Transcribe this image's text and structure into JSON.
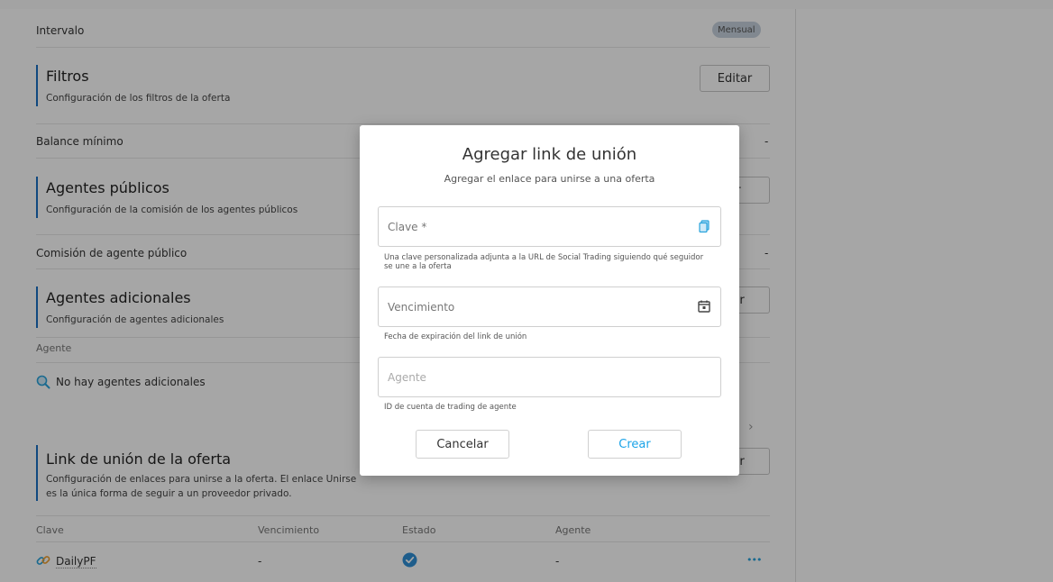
{
  "page": {
    "interval": {
      "label": "Intervalo",
      "badge": "Mensual"
    },
    "filters": {
      "title": "Filtros",
      "description": "Configuración de los filtros de la oferta",
      "edit_button": "Editar",
      "min_balance_label": "Balance mínimo",
      "min_balance_value": "-"
    },
    "public_agents": {
      "title": "Agentes públicos",
      "description": "Configuración de la comisión de los agentes públicos",
      "button_partial": "ar",
      "commission_label": "Comisión de agente público",
      "commission_value": "-"
    },
    "additional_agents": {
      "title": "Agentes adicionales",
      "description": "Configuración de agentes adicionales",
      "button_partial": "gar",
      "column_agent": "Agente",
      "empty_text": "No hay agentes adicionales",
      "chevron": "›"
    },
    "join_links": {
      "title": "Link de unión de la oferta",
      "description": "Configuración de enlaces para unirse a la oferta. El enlace Unirse es la única forma de seguir a un proveedor privado.",
      "button_partial": "gar",
      "columns": [
        "Clave",
        "Vencimiento",
        "Estado",
        "Agente"
      ],
      "rows": [
        {
          "key": "DailyPF",
          "expiry": "-",
          "agent": "-",
          "more": "•••"
        }
      ]
    }
  },
  "modal": {
    "title": "Agregar link de unión",
    "subtitle": "Agregar el enlace para unirse a una oferta",
    "key_field": {
      "placeholder": "Clave *",
      "helper": "Una clave personalizada adjunta a la URL de Social Trading siguiendo qué seguidor se une a la oferta"
    },
    "expiry_field": {
      "placeholder": "Vencimiento",
      "helper": "Fecha de expiración del link de unión"
    },
    "agent_field": {
      "placeholder": "Agente",
      "helper": "ID de cuenta de trading de agente"
    },
    "cancel_label": "Cancelar",
    "create_label": "Crear"
  },
  "colors": {
    "accent": "#1aa3e8",
    "section_bar": "#1a6fc4",
    "overlay": "rgba(0,0,0,0.35)"
  },
  "icons": [
    "copy-icon",
    "calendar-icon",
    "magnifier-icon",
    "link-icon",
    "check-circle-icon",
    "more-icon",
    "chevron-right-icon"
  ]
}
